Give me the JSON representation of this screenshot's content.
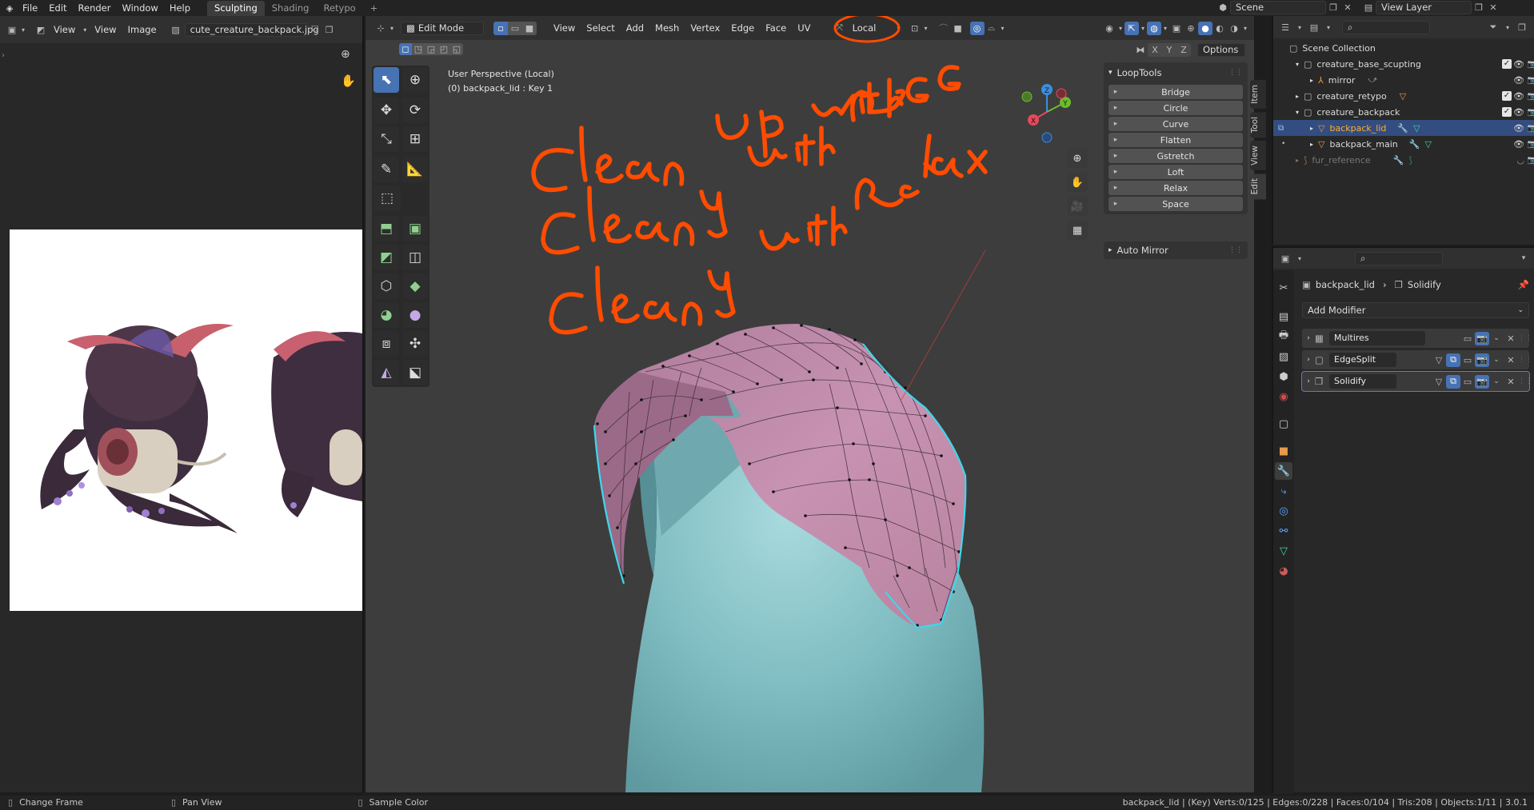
{
  "topbar": {
    "menus": [
      "File",
      "Edit",
      "Render",
      "Window",
      "Help"
    ],
    "workspaces": [
      "Sculpting",
      "Shading",
      "Retypo"
    ],
    "add_tab": "+",
    "scene_label": "Scene",
    "view_layer_label": "View Layer"
  },
  "image_editor": {
    "view_dd": "View",
    "menus": [
      "View",
      "Image"
    ],
    "image_name": "cute_creature_backpack.jpg"
  },
  "viewport": {
    "mode_dd": "Edit Mode",
    "menus": [
      "View",
      "Select",
      "Add",
      "Mesh",
      "Vertex",
      "Edge",
      "Face",
      "UV"
    ],
    "transform_dd": "Local",
    "axes": [
      "X",
      "Y",
      "Z"
    ],
    "options_dd": "Options",
    "persp_text": "User Perspective (Local)",
    "object_text": "(0) backpack_lid : Key 1",
    "annotations": [
      "Clean up with",
      "Clean up with GG",
      "Clean up with Relax"
    ],
    "annotation_color": "#ff4c00"
  },
  "gizmo": {
    "x": "X",
    "y": "Y",
    "z": "Z"
  },
  "loop_tools": {
    "title": "LoopTools",
    "buttons": [
      "Bridge",
      "Circle",
      "Curve",
      "Flatten",
      "Gstretch",
      "Loft",
      "Relax",
      "Space"
    ],
    "auto_mirror": "Auto Mirror"
  },
  "side_tabs": [
    "Item",
    "Tool",
    "View",
    "Edit"
  ],
  "outliner": {
    "root": "Scene Collection",
    "items": [
      {
        "name": "creature_base_scupting",
        "type": "collection",
        "indent": 1,
        "expanded": true
      },
      {
        "name": "mirror",
        "type": "empty",
        "indent": 2
      },
      {
        "name": "creature_retypo",
        "type": "collection",
        "indent": 1,
        "expanded": false
      },
      {
        "name": "creature_backpack",
        "type": "collection",
        "indent": 1,
        "expanded": true
      },
      {
        "name": "backpack_lid",
        "type": "mesh",
        "indent": 2,
        "selected": true
      },
      {
        "name": "backpack_main",
        "type": "mesh",
        "indent": 2
      },
      {
        "name": "fur_reference",
        "type": "curve",
        "indent": 1,
        "dim": true
      }
    ]
  },
  "properties": {
    "breadcrumb_object": "backpack_lid",
    "breadcrumb_modifier": "Solidify",
    "add_modifier": "Add Modifier",
    "modifiers": [
      "Multires",
      "EdgeSplit",
      "Solidify"
    ]
  },
  "statusbar": {
    "items": [
      "Change Frame",
      "Pan View",
      "Sample Color"
    ],
    "stats": "backpack_lid | (Key) Verts:0/125 | Edges:0/228 | Faces:0/104 | Tris:208 | Objects:1/11 | 3.0.1"
  },
  "colors": {
    "accent": "#4772b3",
    "selected_row": "#334d80",
    "mesh_color": "#c28aab",
    "base_color": "#7cbbc0",
    "edge_highlight": "#3fd7ea",
    "orange": "#ff4c00"
  }
}
